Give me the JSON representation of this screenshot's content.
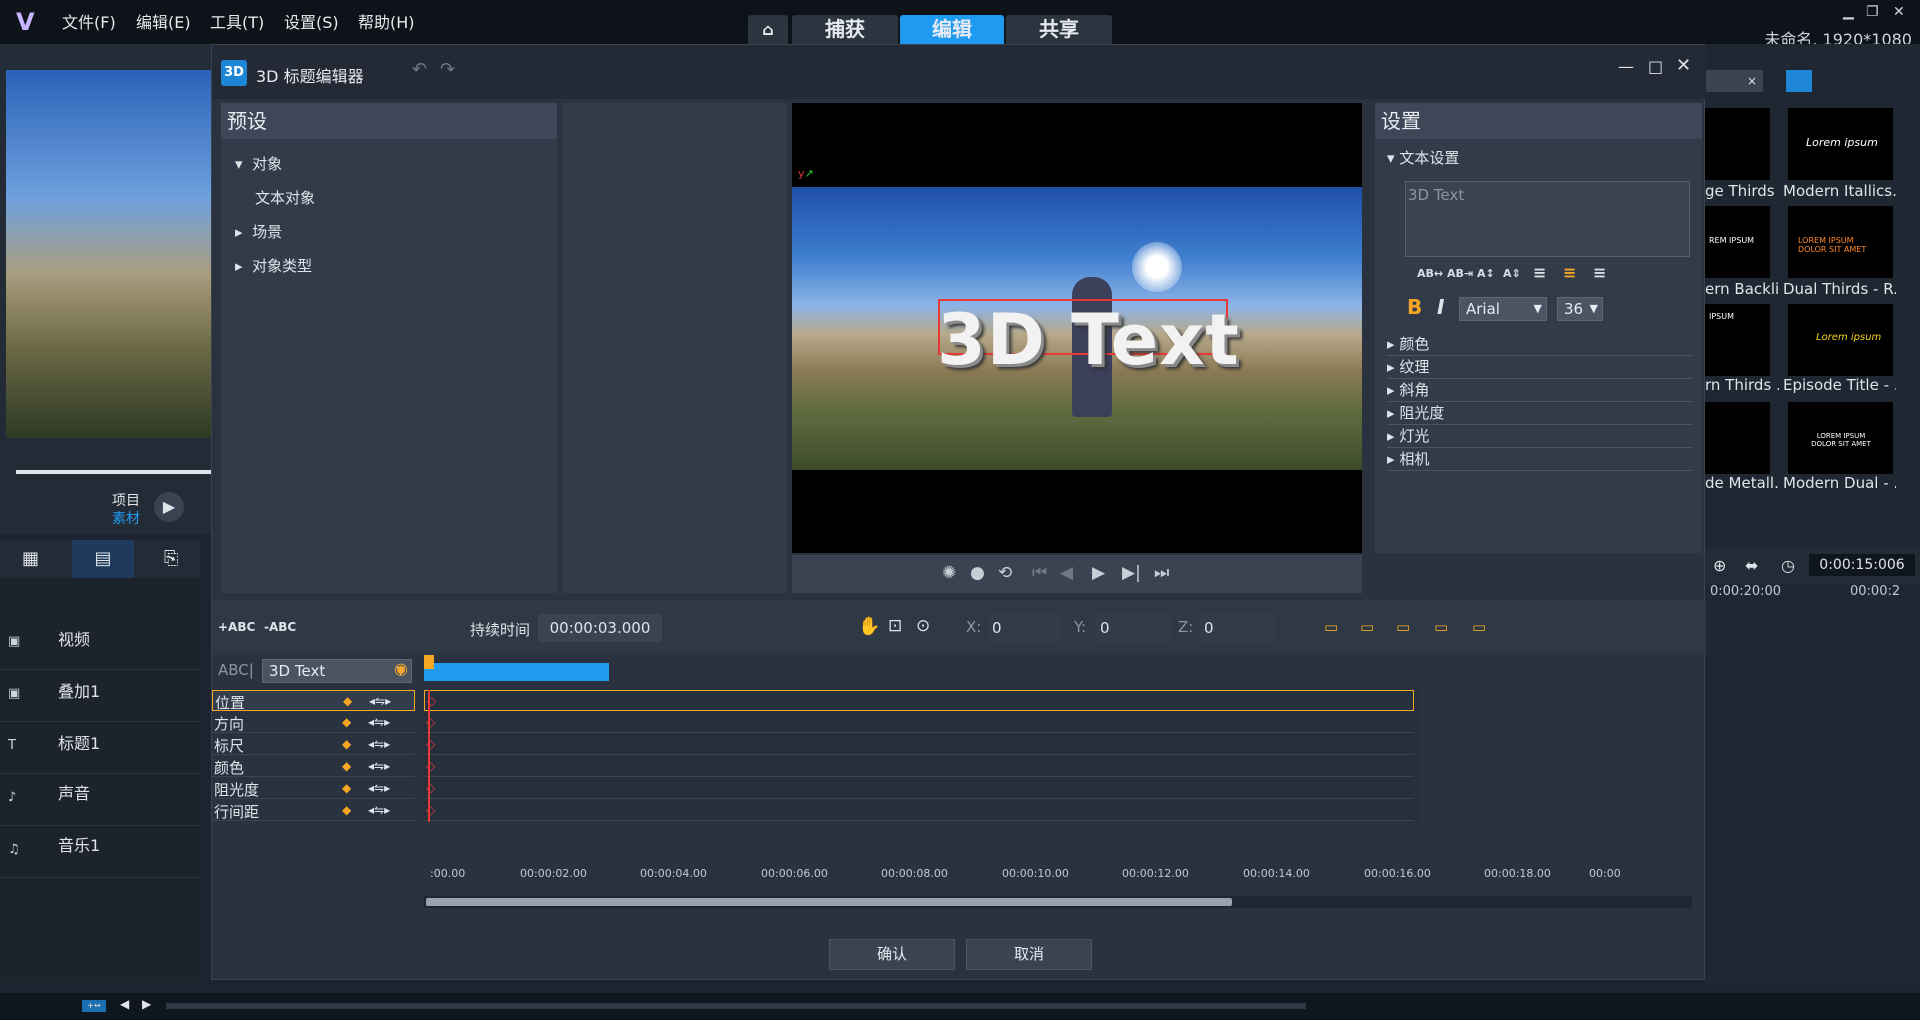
{
  "app": {
    "menu": [
      "文件(F)",
      "编辑(E)",
      "工具(T)",
      "设置(S)",
      "帮助(H)"
    ],
    "mode_tabs": [
      "捕获",
      "编辑",
      "共享"
    ],
    "project_info": "未命名, 1920*1080",
    "timecode": "0:00:15:006",
    "ruler": [
      "0:00:20:00",
      "00:00:2"
    ],
    "track_labels_side": [
      "项目",
      "素材"
    ]
  },
  "tracks": [
    "视频",
    "叠加1",
    "标题1",
    "声音",
    "音乐1"
  ],
  "library": {
    "items": [
      {
        "left": "ge Thirds ...",
        "right": "Modern Itallics..."
      },
      {
        "left": "ern Backli...",
        "right": "Dual Thirds - R..."
      },
      {
        "left": "rn Thirds ...",
        "right": "Episode Title - ..."
      },
      {
        "left": "de Metall...",
        "right": "Modern Dual - ..."
      }
    ],
    "thumb_texts": [
      "Lorem ipsum",
      "LOREM IPSUM DOLOR SIT AMET",
      "Lorem ipsum",
      "LOREM IPSUM DOLOR SIT AMET"
    ],
    "left_thumb_texts": [
      "REM IPSUM",
      "IPSUM"
    ]
  },
  "dialog": {
    "icon": "3D",
    "title": "3D 标题编辑器",
    "presets": {
      "header": "预设",
      "items": [
        "对象",
        "文本对象",
        "场景",
        "对象类型"
      ]
    },
    "preview_text": "3D Text",
    "settings": {
      "header": "设置",
      "text_settings": "文本设置",
      "text_value": "3D Text",
      "font": "Arial",
      "size": "36",
      "bold": "B",
      "italic": "I",
      "sections": [
        "颜色",
        "纹理",
        "斜角",
        "阻光度",
        "灯光",
        "相机"
      ]
    },
    "timeline": {
      "add_text": "+ABC",
      "remove_text": "-ABC",
      "duration_label": "持续时间",
      "duration": "00:00:03.000",
      "x_label": "X:",
      "x": "0",
      "y_label": "Y:",
      "y": "0",
      "z_label": "Z:",
      "z": "0",
      "object_label": "ABC|",
      "object": "3D Text",
      "properties": [
        "位置",
        "方向",
        "标尺",
        "颜色",
        "阻光度",
        "行间距"
      ],
      "ticks": [
        ":00.00",
        "00:00:02.00",
        "00:00:04.00",
        "00:00:06.00",
        "00:00:08.00",
        "00:00:10.00",
        "00:00:12.00",
        "00:00:14.00",
        "00:00:16.00",
        "00:00:18.00",
        "00:00"
      ]
    },
    "buttons": {
      "ok": "确认",
      "cancel": "取消"
    }
  }
}
